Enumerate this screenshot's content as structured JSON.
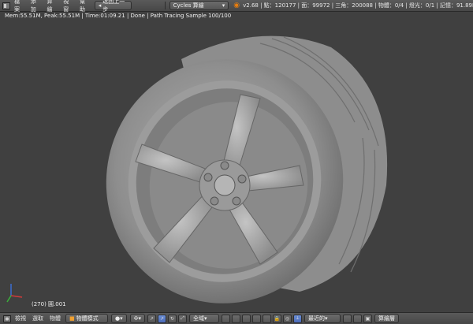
{
  "topbar": {
    "menus": [
      "檔案",
      "添加",
      "算繪",
      "視窗",
      "幫助"
    ],
    "undo_label": "返回上一步",
    "engine": "Cycles 算繪",
    "stats": "v2.68 | 點：120177 | 面：99972 | 三角：200088 | 物體：0/4 | 燈光：0/1 | 記憶：91.89M (0.11M) | 物..."
  },
  "viewport": {
    "render_info": "Mem:55.51M, Peak:55.51M | Time:01:09.21 | Done | Path Tracing Sample 100/100",
    "object_label": "(270) 圓.001"
  },
  "bottombar": {
    "menus": [
      "檢視",
      "選取",
      "物體"
    ],
    "mode": "物體模式",
    "orientation": "全域",
    "pivot": "最近的",
    "render_button": "算繪層"
  }
}
